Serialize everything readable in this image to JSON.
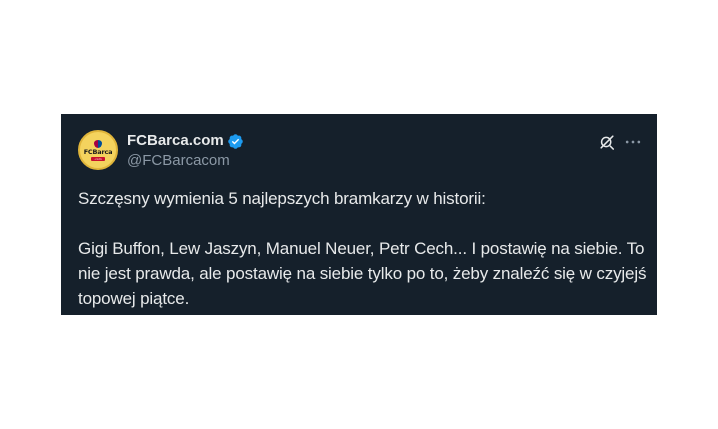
{
  "tweet": {
    "author": {
      "display_name": "FCBarca.com",
      "handle": "@FCBarcacom",
      "avatar_text": "FCBarca",
      "avatar_sub": ".com",
      "verified": true
    },
    "text_lines": [
      "Szczęsny wymienia 5 najlepszych bramkarzy w historii:",
      "Gigi Buffon, Lew Jaszyn, Manuel Neuer, Petr Cech... I postawię na siebie. To nie jest prawda, ale postawię na siebie tylko po to, żeby znaleźć się w czyjejś topowej piątce."
    ]
  },
  "icons": {
    "verified": "verified-badge-icon",
    "grok": "grok-icon",
    "more": "more-options-icon"
  },
  "colors": {
    "card_background": "#15202b",
    "text_primary": "#e7e9ea",
    "text_secondary": "#8b98a5",
    "verified_blue": "#1d9bf0",
    "page_background": "#ffffff"
  }
}
